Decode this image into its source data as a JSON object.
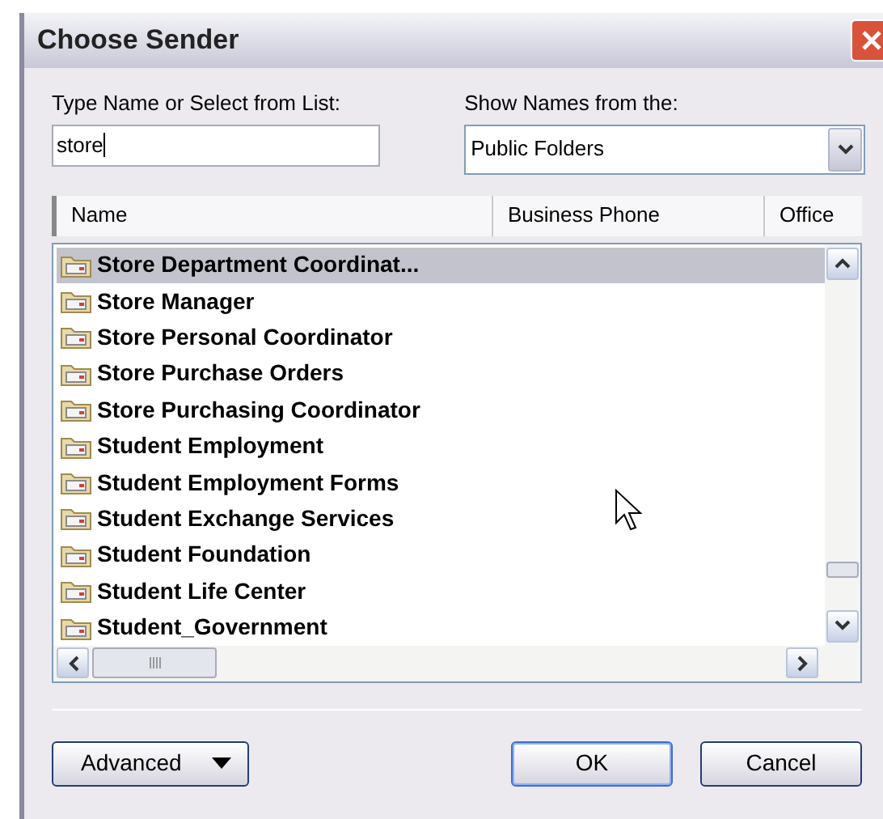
{
  "window": {
    "title": "Choose Sender"
  },
  "name_field": {
    "label": "Type Name or Select from List:",
    "value": "store"
  },
  "address_book": {
    "label": "Show Names from the:",
    "value": "Public Folders"
  },
  "table": {
    "columns": [
      "Name",
      "Business Phone",
      "Office"
    ],
    "rows": [
      {
        "name": "Store Department Coordinat...",
        "selected": true
      },
      {
        "name": "Store Manager",
        "selected": false
      },
      {
        "name": "Store Personal Coordinator",
        "selected": false
      },
      {
        "name": "Store Purchase Orders",
        "selected": false
      },
      {
        "name": "Store Purchasing Coordinator",
        "selected": false
      },
      {
        "name": "Student Employment",
        "selected": false
      },
      {
        "name": "Student Employment Forms",
        "selected": false
      },
      {
        "name": "Student Exchange Services",
        "selected": false
      },
      {
        "name": "Student Foundation",
        "selected": false
      },
      {
        "name": "Student Life Center",
        "selected": false
      },
      {
        "name": "Student_Government",
        "selected": false
      }
    ]
  },
  "buttons": {
    "advanced": "Advanced",
    "ok": "OK",
    "cancel": "Cancel"
  }
}
